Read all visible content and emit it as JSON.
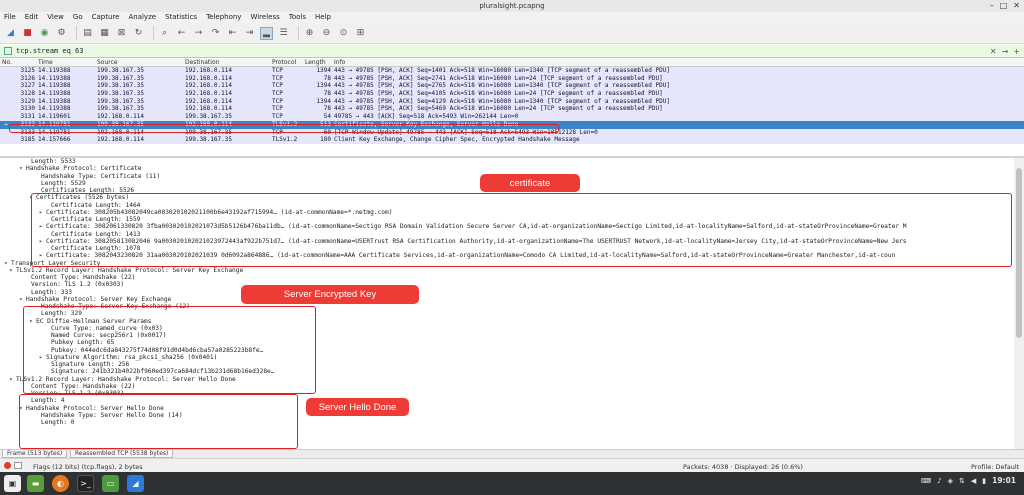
{
  "window": {
    "title": "pluralsight.pcapng"
  },
  "menu": [
    "File",
    "Edit",
    "View",
    "Go",
    "Capture",
    "Analyze",
    "Statistics",
    "Telephony",
    "Wireless",
    "Tools",
    "Help"
  ],
  "filter": {
    "value": "tcp.stream eq 63"
  },
  "packet_list": {
    "columns": [
      "No.",
      "Time",
      "Source",
      "Destination",
      "Protocol",
      "Length",
      "Info"
    ],
    "rows": [
      {
        "no": "3125",
        "time": "14.119388",
        "src": "199.38.167.35",
        "dst": "192.168.0.114",
        "proto": "TCP",
        "len": "1394",
        "info": "443 → 49785 [PSH, ACK] Seq=1401 Ack=518 Win=16080 Len=1340 [TCP segment of a reassembled PDU]"
      },
      {
        "no": "3126",
        "time": "14.119388",
        "src": "199.38.167.35",
        "dst": "192.168.0.114",
        "proto": "TCP",
        "len": "78",
        "info": "443 → 49785 [PSH, ACK] Seq=2741 Ack=518 Win=16080 Len=24 [TCP segment of a reassembled PDU]"
      },
      {
        "no": "3127",
        "time": "14.119388",
        "src": "199.38.167.35",
        "dst": "192.168.0.114",
        "proto": "TCP",
        "len": "1394",
        "info": "443 → 49785 [PSH, ACK] Seq=2765 Ack=518 Win=16080 Len=1340 [TCP segment of a reassembled PDU]"
      },
      {
        "no": "3128",
        "time": "14.119388",
        "src": "199.38.167.35",
        "dst": "192.168.0.114",
        "proto": "TCP",
        "len": "78",
        "info": "443 → 49785 [PSH, ACK] Seq=4105 Ack=518 Win=16080 Len=24 [TCP segment of a reassembled PDU]"
      },
      {
        "no": "3129",
        "time": "14.119388",
        "src": "199.38.167.35",
        "dst": "192.168.0.114",
        "proto": "TCP",
        "len": "1394",
        "info": "443 → 49785 [PSH, ACK] Seq=4129 Ack=518 Win=16080 Len=1340 [TCP segment of a reassembled PDU]"
      },
      {
        "no": "3130",
        "time": "14.119388",
        "src": "199.38.167.35",
        "dst": "192.168.0.114",
        "proto": "TCP",
        "len": "78",
        "info": "443 → 49785 [PSH, ACK] Seq=5469 Ack=518 Win=16080 Len=24 [TCP segment of a reassembled PDU]"
      },
      {
        "no": "3131",
        "time": "14.119601",
        "src": "192.168.0.114",
        "dst": "199.38.167.35",
        "proto": "TCP",
        "len": "54",
        "info": "49785 → 443 [ACK] Seq=518 Ack=5493 Win=262144 Len=0"
      },
      {
        "no": "3132",
        "time": "14.119781",
        "src": "199.38.167.35",
        "dst": "192.168.0.114",
        "proto": "TLSv1.2",
        "len": "513",
        "info": "Certificate, Server Key Exchange, Server Hello Done"
      },
      {
        "no": "3133",
        "time": "14.119781",
        "src": "192.168.0.114",
        "dst": "199.38.167.35",
        "proto": "TCP",
        "len": "60",
        "info": "[TCP Window Update] 49785 → 443 [ACK] Seq=518 Ack=5493 Win=10512128 Len=0"
      },
      {
        "no": "3185",
        "time": "14.157666",
        "src": "192.168.0.114",
        "dst": "199.38.167.35",
        "proto": "TLSv1.2",
        "len": "180",
        "info": "Client Key Exchange, Change Cipher Spec, Encrypted Handshake Message"
      }
    ]
  },
  "details": [
    {
      "t": "Length: 5533",
      "i": 4,
      "a": ""
    },
    {
      "t": "Handshake Protocol: Certificate",
      "i": 3,
      "a": "▾"
    },
    {
      "t": "Handshake Type: Certificate (11)",
      "i": 6,
      "a": ""
    },
    {
      "t": "Length: 5529",
      "i": 6,
      "a": ""
    },
    {
      "t": "Certificates Length: 5526",
      "i": 6,
      "a": ""
    },
    {
      "t": "Certificates (5526 bytes)",
      "i": 5,
      "a": "▾"
    },
    {
      "t": "Certificate Length: 1464",
      "i": 8,
      "a": ""
    },
    {
      "t": "Certificate: 308205b43082049ca003020102021100b6e43192af715994… (id-at-commonName=*.netmg.com)",
      "i": 7,
      "a": "▸"
    },
    {
      "t": "Certificate Length: 1559",
      "i": 8,
      "a": ""
    },
    {
      "t": "Certificate: 3082061330820 3fba003020102021073d5b5126b476ba11db… (id-at-commonName=Sectigo RSA Domain Validation Secure Server CA,id-at-organizationName=Sectigo Limited,id-at-localityName=Salford,id-at-stateOrProvinceName=Greater M",
      "i": 7,
      "a": "▸"
    },
    {
      "t": "Certificate Length: 1413",
      "i": 8,
      "a": ""
    },
    {
      "t": "Certificate: 308205813082046 9a003020102021023972443af922b751d7… (id-at-commonName=USERTrust RSA Certification Authority,id-at-organizationName=The USERTRUST Network,id-at-localityName=Jersey City,id-at-stateOrProvinceName=New Jers",
      "i": 7,
      "a": "▸"
    },
    {
      "t": "Certificate Length: 1078",
      "i": 8,
      "a": ""
    },
    {
      "t": "Certificate: 3082043230820 31aa003020102021039 0d6092a864886… (id-at-commonName=AAA Certificate Services,id-at-organizationName=Comodo CA Limited,id-at-localityName=Salford,id-at-stateOrProvinceName=Greater Manchester,id-at-coun",
      "i": 7,
      "a": "▸"
    },
    {
      "t": "Transport Layer Security",
      "i": 0,
      "a": "▾"
    },
    {
      "t": "TLSv1.2 Record Layer: Handshake Protocol: Server Key Exchange",
      "i": 1,
      "a": "▾"
    },
    {
      "t": "Content Type: Handshake (22)",
      "i": 4,
      "a": ""
    },
    {
      "t": "Version: TLS 1.2 (0x0303)",
      "i": 4,
      "a": ""
    },
    {
      "t": "Length: 333",
      "i": 4,
      "a": ""
    },
    {
      "t": "Handshake Protocol: Server Key Exchange",
      "i": 3,
      "a": "▾"
    },
    {
      "t": "Handshake Type: Server Key Exchange (12)",
      "i": 6,
      "a": ""
    },
    {
      "t": "Length: 329",
      "i": 6,
      "a": ""
    },
    {
      "t": "EC Diffie-Hellman Server Params",
      "i": 5,
      "a": "▾"
    },
    {
      "t": "Curve Type: named_curve (0x03)",
      "i": 8,
      "a": ""
    },
    {
      "t": "Named Curve: secp256r1 (0x0017)",
      "i": 8,
      "a": ""
    },
    {
      "t": "Pubkey Length: 65",
      "i": 8,
      "a": ""
    },
    {
      "t": "Pubkey: 044edc6da843275f74d08f91d0d4bd6cba57a0285223b8fe…",
      "i": 8,
      "a": ""
    },
    {
      "t": "Signature Algorithm: rsa_pkcs1_sha256 (0x0401)",
      "i": 7,
      "a": "▸"
    },
    {
      "t": "Signature Length: 256",
      "i": 8,
      "a": ""
    },
    {
      "t": "Signature: 241b321b4022bf960ed397ca684dcf13b231d68b16ed328e…",
      "i": 8,
      "a": ""
    },
    {
      "t": "TLSv1.2 Record Layer: Handshake Protocol: Server Hello Done",
      "i": 1,
      "a": "▾"
    },
    {
      "t": "Content Type: Handshake (22)",
      "i": 4,
      "a": ""
    },
    {
      "t": "Version: TLS 1.2 (0x0303)",
      "i": 4,
      "a": ""
    },
    {
      "t": "Length: 4",
      "i": 4,
      "a": ""
    },
    {
      "t": "Handshake Protocol: Server Hello Done",
      "i": 3,
      "a": "▾"
    },
    {
      "t": "Handshake Type: Server Hello Done (14)",
      "i": 6,
      "a": ""
    },
    {
      "t": "Length: 0",
      "i": 6,
      "a": ""
    }
  ],
  "annotations": {
    "certificate": "certificate",
    "server_key": "Server Encrypted Key",
    "hello_done": "Server Hello Done"
  },
  "bottom_tabs": [
    "Frame (513 bytes)",
    "Reassembled TCP (5538 bytes)"
  ],
  "status": {
    "field": "Flags (12 bits) (tcp.flags), 2 bytes",
    "packets": "Packets: 4038 · Displayed: 26 (0.6%)",
    "profile": "Profile: Default"
  },
  "taskbar": {
    "clock": "19:01"
  },
  "colors": {
    "selected_row": "#3a85c7",
    "tcp_row": "#e6e6fa",
    "annotation": "#ef3b35",
    "filter_bg": "#e7fbe2"
  }
}
